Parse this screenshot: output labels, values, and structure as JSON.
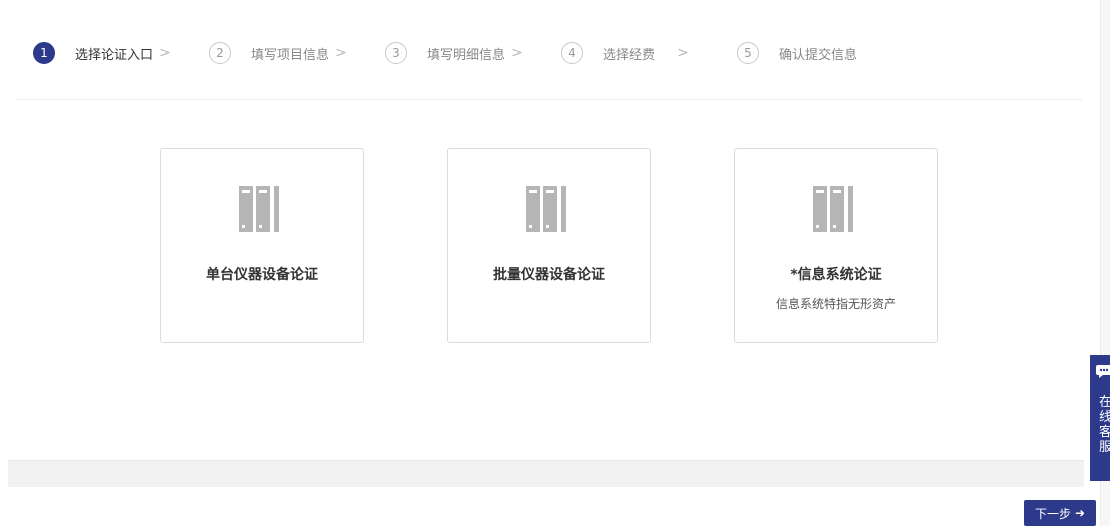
{
  "steps": [
    {
      "number": "1",
      "label": "选择论证入口",
      "active": true
    },
    {
      "number": "2",
      "label": "填写项目信息",
      "active": false
    },
    {
      "number": "3",
      "label": "填写明细信息",
      "active": false
    },
    {
      "number": "4",
      "label": "选择经费",
      "active": false
    },
    {
      "number": "5",
      "label": "确认提交信息",
      "active": false
    }
  ],
  "chevron": ">",
  "cards": [
    {
      "title": "单台仪器设备论证",
      "desc": "",
      "icon": "server-rack-icon"
    },
    {
      "title": "批量仪器设备论证",
      "desc": "",
      "icon": "server-rack-icon"
    },
    {
      "title": "*信息系统论证",
      "desc": "信息系统特指无形资产",
      "icon": "server-rack-icon"
    }
  ],
  "next_button": {
    "label": "下一步",
    "arrow": "➜"
  },
  "service_widget": {
    "label": "在线客服",
    "icon": "chat-bubble-icon"
  },
  "colors": {
    "primary": "#2d3a8c",
    "icon_gray": "#b5b5b5",
    "border": "#dcdcdc"
  }
}
